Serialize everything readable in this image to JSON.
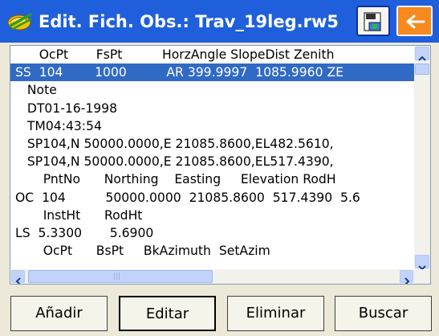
{
  "window": {
    "title": "Edit. Fich. Obs.: Trav_19leg.rw5",
    "icons": {
      "app": "survey-dish-icon",
      "save": "save-file-icon",
      "back": "back-arrow-icon"
    },
    "colors": {
      "titlebar": "#1F5FDC",
      "back_button": "#F7891E",
      "selection": "#316AC5"
    }
  },
  "list": {
    "rows": [
      "      OcPt       FsPt          HorzAngle SlopeDist Zenith",
      "SS  104        1000          AR 399.9997  1085.9960 ZE",
      "   Note",
      "   DT01-16-1998",
      "   TM04:43:54",
      "   SP104,N 50000.0000,E 21085.8600,EL482.5610,",
      "   SP104,N 50000.0000,E 21085.8600,EL517.4390,",
      "       PntNo      Northing    Easting     Elevation RodH",
      "OC  104          50000.0000  21085.8600  517.4390  5.6",
      "       InstHt      RodHt",
      "LS  5.3300       5.6900",
      "       OcPt      BsPt     BkAzimuth  SetAzim"
    ],
    "selected_index": 1
  },
  "buttons": {
    "add": "Añadir",
    "edit": "Editar",
    "delete": "Eliminar",
    "search": "Buscar"
  }
}
